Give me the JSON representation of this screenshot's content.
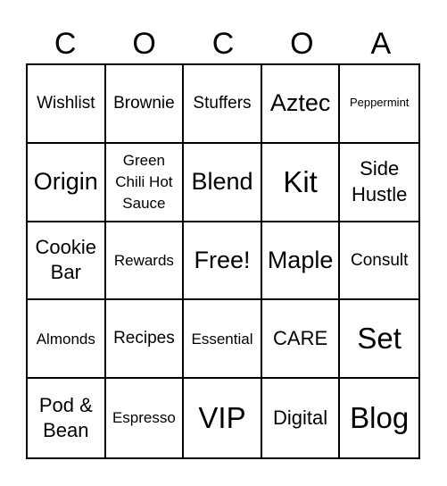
{
  "card": {
    "header": [
      "C",
      "O",
      "C",
      "O",
      "A"
    ],
    "cells": [
      [
        "Wishlist",
        "Brownie",
        "Stuffers",
        "Aztec",
        "Peppermint"
      ],
      [
        "Origin",
        "Green Chili Hot Sauce",
        "Blend",
        "Kit",
        "Side Hustle"
      ],
      [
        "Cookie Bar",
        "Rewards",
        "Free!",
        "Maple",
        "Consult"
      ],
      [
        "Almonds",
        "Recipes",
        "Essential",
        "CARE",
        "Set"
      ],
      [
        "Pod & Bean",
        "Espresso",
        "VIP",
        "Digital",
        "Blog"
      ]
    ]
  }
}
